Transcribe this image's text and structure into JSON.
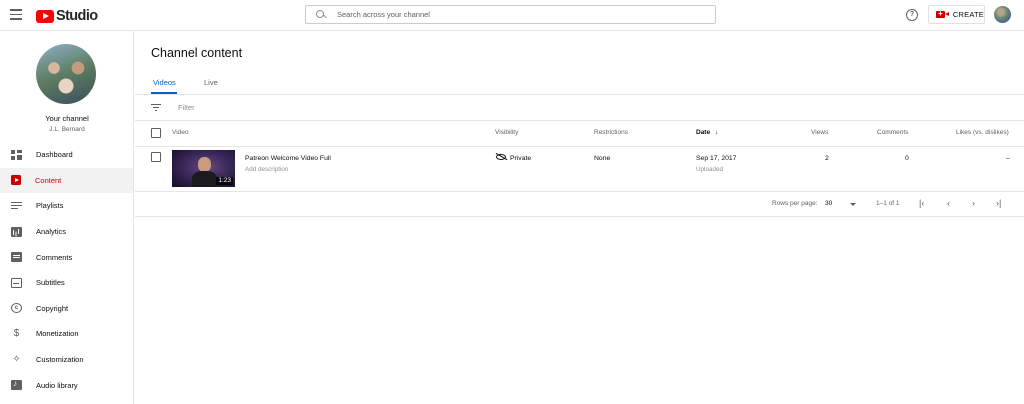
{
  "header": {
    "logo_text": "Studio",
    "search_placeholder": "Search across your channel",
    "help_glyph": "?",
    "create_label": "CREATE"
  },
  "sidebar": {
    "channel_label": "Your channel",
    "channel_name": "J.L. Bernard",
    "items": [
      {
        "label": "Dashboard",
        "icon": "dashboard-icon"
      },
      {
        "label": "Content",
        "icon": "content-icon",
        "active": true
      },
      {
        "label": "Playlists",
        "icon": "playlists-icon"
      },
      {
        "label": "Analytics",
        "icon": "analytics-icon"
      },
      {
        "label": "Comments",
        "icon": "comments-icon"
      },
      {
        "label": "Subtitles",
        "icon": "subtitles-icon"
      },
      {
        "label": "Copyright",
        "icon": "copyright-icon"
      },
      {
        "label": "Monetization",
        "icon": "monetization-icon"
      },
      {
        "label": "Customization",
        "icon": "customization-icon"
      },
      {
        "label": "Audio library",
        "icon": "audio-library-icon"
      }
    ]
  },
  "main": {
    "title": "Channel content",
    "tabs": [
      "Videos",
      "Live"
    ],
    "filter_placeholder": "Filter",
    "columns": {
      "video": "Video",
      "visibility": "Visibility",
      "restrictions": "Restrictions",
      "date": "Date",
      "views": "Views",
      "comments": "Comments",
      "likes": "Likes (vs. dislikes)"
    },
    "sort_arrow": "↓",
    "rows": [
      {
        "title": "Patreon Welcome Video Full",
        "description": "Add description",
        "duration": "1:23",
        "visibility": "Private",
        "restrictions": "None",
        "date": "Sep 17, 2017",
        "date_status": "Uploaded",
        "views": "2",
        "comments": "0",
        "likes": "–"
      }
    ],
    "pagination": {
      "rows_per_page_label": "Rows per page:",
      "rows_per_page": "30",
      "range": "1–1 of 1",
      "first": "|‹",
      "prev": "‹",
      "next": "›",
      "last": "›|"
    }
  },
  "colors": {
    "brand_red": "#ff0000",
    "active_red": "#cc0000",
    "tab_blue": "#065fd4"
  }
}
